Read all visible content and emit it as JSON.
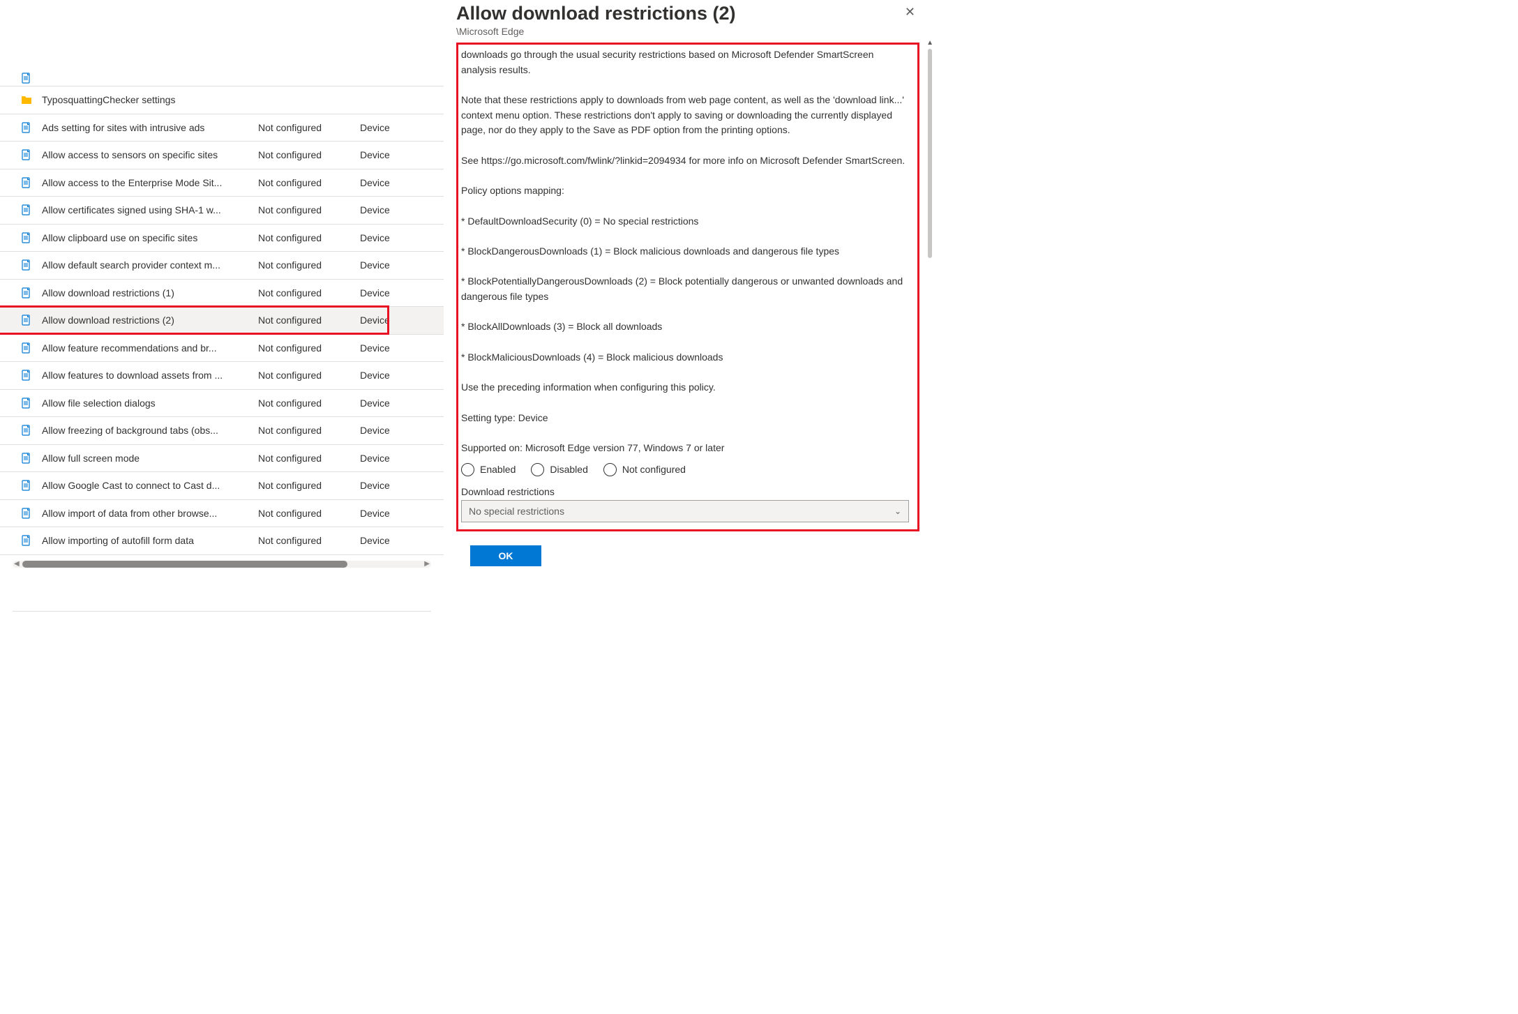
{
  "panel": {
    "title": "Allow download restrictions (2)",
    "subtitle": "\\Microsoft Edge",
    "ok_label": "OK"
  },
  "rows": [
    {
      "idx": 0,
      "kind": "folder",
      "name": "TyposquattingChecker settings",
      "state": "",
      "scope": ""
    },
    {
      "idx": 1,
      "kind": "setting",
      "name": "Ads setting for sites with intrusive ads",
      "state": "Not configured",
      "scope": "Device"
    },
    {
      "idx": 2,
      "kind": "setting",
      "name": "Allow access to sensors on specific sites",
      "state": "Not configured",
      "scope": "Device"
    },
    {
      "idx": 3,
      "kind": "setting",
      "name": "Allow access to the Enterprise Mode Sit...",
      "state": "Not configured",
      "scope": "Device"
    },
    {
      "idx": 4,
      "kind": "setting",
      "name": "Allow certificates signed using SHA-1 w...",
      "state": "Not configured",
      "scope": "Device"
    },
    {
      "idx": 5,
      "kind": "setting",
      "name": "Allow clipboard use on specific sites",
      "state": "Not configured",
      "scope": "Device"
    },
    {
      "idx": 6,
      "kind": "setting",
      "name": "Allow default search provider context m...",
      "state": "Not configured",
      "scope": "Device"
    },
    {
      "idx": 7,
      "kind": "setting",
      "name": "Allow download restrictions (1)",
      "state": "Not configured",
      "scope": "Device"
    },
    {
      "idx": 8,
      "kind": "setting",
      "name": "Allow download restrictions (2)",
      "state": "Not configured",
      "scope": "Device",
      "selected": true
    },
    {
      "idx": 9,
      "kind": "setting",
      "name": "Allow feature recommendations and br...",
      "state": "Not configured",
      "scope": "Device"
    },
    {
      "idx": 10,
      "kind": "setting",
      "name": "Allow features to download assets from ...",
      "state": "Not configured",
      "scope": "Device"
    },
    {
      "idx": 11,
      "kind": "setting",
      "name": "Allow file selection dialogs",
      "state": "Not configured",
      "scope": "Device"
    },
    {
      "idx": 12,
      "kind": "setting",
      "name": "Allow freezing of background tabs (obs...",
      "state": "Not configured",
      "scope": "Device"
    },
    {
      "idx": 13,
      "kind": "setting",
      "name": "Allow full screen mode",
      "state": "Not configured",
      "scope": "Device"
    },
    {
      "idx": 14,
      "kind": "setting",
      "name": "Allow Google Cast to connect to Cast d...",
      "state": "Not configured",
      "scope": "Device"
    },
    {
      "idx": 15,
      "kind": "setting",
      "name": "Allow import of data from other browse...",
      "state": "Not configured",
      "scope": "Device"
    },
    {
      "idx": 16,
      "kind": "setting",
      "name": "Allow importing of autofill form data",
      "state": "Not configured",
      "scope": "Device"
    }
  ],
  "description_text": "downloads go through the usual security restrictions based on Microsoft Defender SmartScreen analysis results.\n\nNote that these restrictions apply to downloads from web page content, as well as the 'download link...' context menu option. These restrictions don't apply to saving or downloading the currently displayed page, nor do they apply to the Save as PDF option from the printing options.\n\nSee https://go.microsoft.com/fwlink/?linkid=2094934 for more info on Microsoft Defender SmartScreen.\n\nPolicy options mapping:\n\n* DefaultDownloadSecurity (0) = No special restrictions\n\n* BlockDangerousDownloads (1) = Block malicious downloads and dangerous file types\n\n* BlockPotentiallyDangerousDownloads (2) = Block potentially dangerous or unwanted downloads and dangerous file types\n\n* BlockAllDownloads (3) = Block all downloads\n\n* BlockMaliciousDownloads (4) = Block malicious downloads\n\nUse the preceding information when configuring this policy.\n\nSetting type: Device\n\nSupported on: Microsoft Edge version 77, Windows 7 or later",
  "radio_options": {
    "enabled": "Enabled",
    "disabled": "Disabled",
    "not_configured": "Not configured"
  },
  "dropdown": {
    "label": "Download restrictions",
    "value": "No special restrictions"
  },
  "icons": {
    "folder_color": "#ffb900",
    "setting_stroke": "#0078d4"
  }
}
